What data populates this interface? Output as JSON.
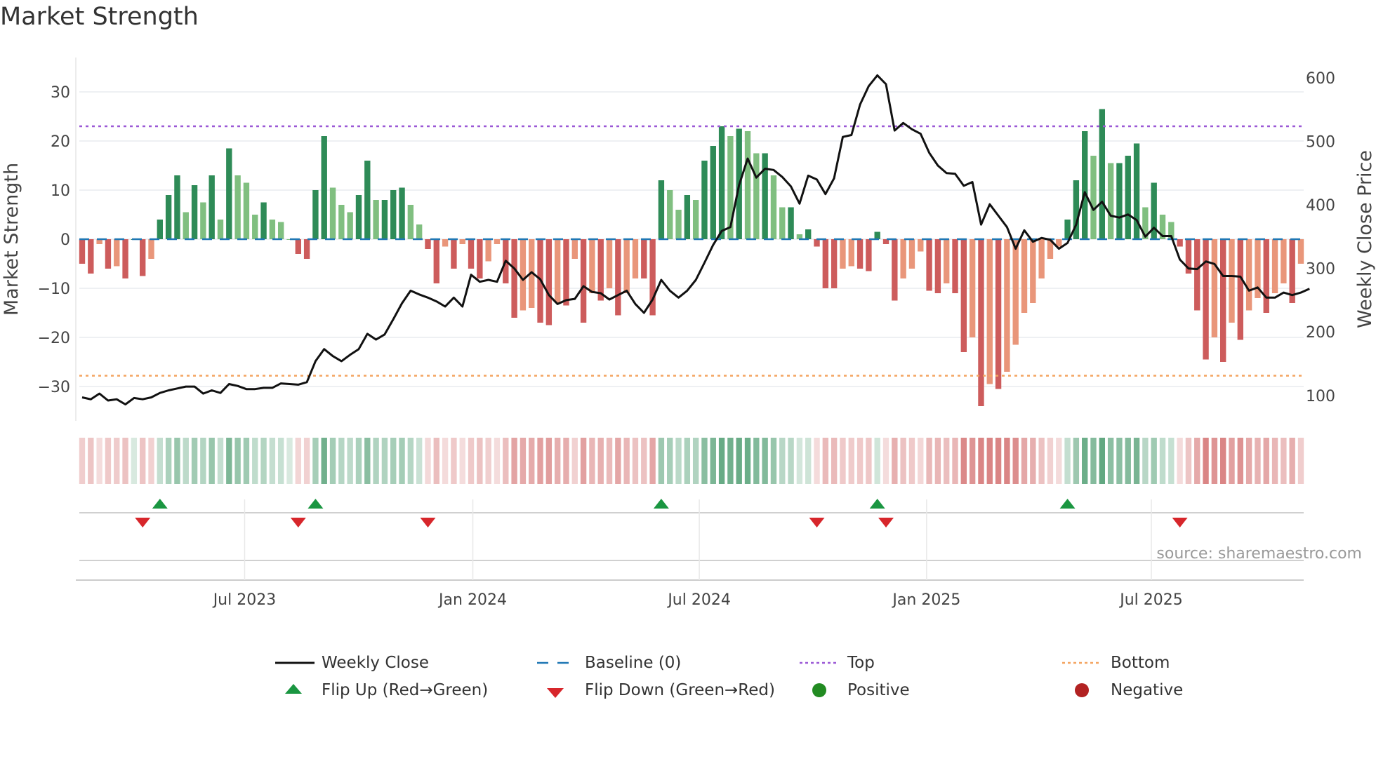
{
  "title": "Market Strength",
  "source": "source: sharemaestro.com",
  "colors": {
    "pos_strong": "#2e8b57",
    "pos_weak": "#80bf80",
    "neg_strong": "#cd5c5c",
    "neg_weak": "#e9967a",
    "price": "#111111",
    "baseline": "#1f77b4",
    "top": "#9b59d6",
    "bottom": "#f4a460",
    "flip_up": "#1a9641",
    "flip_down": "#d7262b",
    "positive": "#228b22",
    "negative": "#b22222"
  },
  "legend": [
    {
      "label": "Weekly Close",
      "icon": "solid-line"
    },
    {
      "label": "Baseline (0)",
      "icon": "dashed-line"
    },
    {
      "label": "Top",
      "icon": "dotted-line-purple"
    },
    {
      "label": "Bottom",
      "icon": "dotted-line-orange"
    },
    {
      "label": "Flip Up (Red→Green)",
      "icon": "triangle-up"
    },
    {
      "label": "Flip Down (Green→Red)",
      "icon": "triangle-down"
    },
    {
      "label": "Positive",
      "icon": "circle-green"
    },
    {
      "label": "Negative",
      "icon": "circle-red"
    }
  ],
  "chart_data": {
    "type": "bar",
    "title": "Market Strength",
    "ylabel": "Market Strength",
    "y2label": "Weekly Close Price",
    "ylim": [
      -37,
      37
    ],
    "y2lim": [
      60,
      632
    ],
    "yticks": [
      -30,
      -20,
      -10,
      0,
      10,
      20,
      30
    ],
    "yticklabels": [
      "−30",
      "−20",
      "−10",
      "0",
      "10",
      "20",
      "30"
    ],
    "y2ticks": [
      100,
      200,
      300,
      400,
      500,
      600
    ],
    "y2ticklabels": [
      "100",
      "200",
      "300",
      "400",
      "500",
      "600"
    ],
    "xticks": [
      {
        "label": "Jul 2023",
        "index": 18.8
      },
      {
        "label": "Jan 2024",
        "index": 45.2
      },
      {
        "label": "Jul 2024",
        "index": 71.4
      },
      {
        "label": "Jan 2025",
        "index": 97.7
      },
      {
        "label": "Jul 2025",
        "index": 123.7
      }
    ],
    "top_level": 23,
    "bottom_level": -27.8,
    "baseline": 0,
    "strength": [
      -5,
      -7,
      -1,
      -6,
      -5.5,
      -8,
      0,
      -7.5,
      -4,
      4,
      9,
      13,
      5.5,
      11,
      7.5,
      13,
      4,
      18.5,
      13,
      11.5,
      5,
      7.5,
      4,
      3.5,
      0,
      -3,
      -4,
      10,
      21,
      10.5,
      7,
      5.5,
      9,
      16,
      8,
      8,
      10,
      10.5,
      7,
      3,
      -2,
      -9,
      -1.5,
      -6,
      -1,
      -6,
      -8,
      -4.5,
      -1,
      -9,
      -16,
      -14.5,
      -14,
      -17,
      -17.5,
      -13,
      -13.5,
      -4,
      -17,
      -11,
      -12.5,
      -10,
      -15.5,
      -11,
      -8,
      -8,
      -15.5,
      12,
      10,
      6,
      9,
      8,
      16,
      19,
      23,
      21,
      22.5,
      22,
      17.5,
      17.5,
      13,
      6.5,
      6.5,
      1,
      2,
      -1.5,
      -10,
      -10,
      -6,
      -5.5,
      -6,
      -6.5,
      1.5,
      -1,
      -12.5,
      -8,
      -6,
      -2.5,
      -10.5,
      -11,
      -9,
      -11,
      -23,
      -20,
      -34,
      -29.5,
      -30.5,
      -27,
      -21.5,
      -15,
      -13,
      -8,
      -4,
      -1.5,
      4,
      12,
      22,
      17,
      26.5,
      15.5,
      15.5,
      17,
      19.5,
      6.5,
      11.5,
      5,
      3.5,
      -1.5,
      -7,
      -14.5,
      -24.5,
      -20,
      -25,
      -17,
      -20.5,
      -14.5,
      -12,
      -15,
      -11,
      -9,
      -13,
      -5
    ],
    "weekly_close": [
      97,
      94,
      103,
      92,
      94,
      86,
      96,
      94,
      97,
      104,
      108,
      111,
      114,
      114,
      103,
      108,
      104,
      118,
      115,
      110,
      110,
      112,
      112,
      119,
      118,
      117,
      121,
      154,
      173,
      162,
      154,
      164,
      173,
      197,
      188,
      196,
      220,
      245,
      265,
      259,
      254,
      248,
      240,
      254,
      240,
      290,
      279,
      282,
      279,
      312,
      300,
      282,
      294,
      283,
      258,
      244,
      250,
      252,
      272,
      263,
      261,
      251,
      258,
      265,
      244,
      230,
      251,
      282,
      265,
      254,
      265,
      282,
      309,
      337,
      359,
      365,
      431,
      473,
      443,
      457,
      455,
      444,
      429,
      402,
      446,
      440,
      417,
      442,
      507,
      510,
      558,
      587,
      604,
      590,
      517,
      529,
      519,
      512,
      482,
      462,
      450,
      449,
      430,
      436,
      369,
      401,
      383,
      365,
      331,
      360,
      342,
      348,
      345,
      331,
      340,
      369,
      420,
      392,
      405,
      383,
      380,
      385,
      376,
      350,
      364,
      351,
      351,
      314,
      300,
      299,
      311,
      307,
      288,
      288,
      287,
      265,
      270,
      254,
      254,
      262,
      258,
      262,
      268
    ]
  }
}
